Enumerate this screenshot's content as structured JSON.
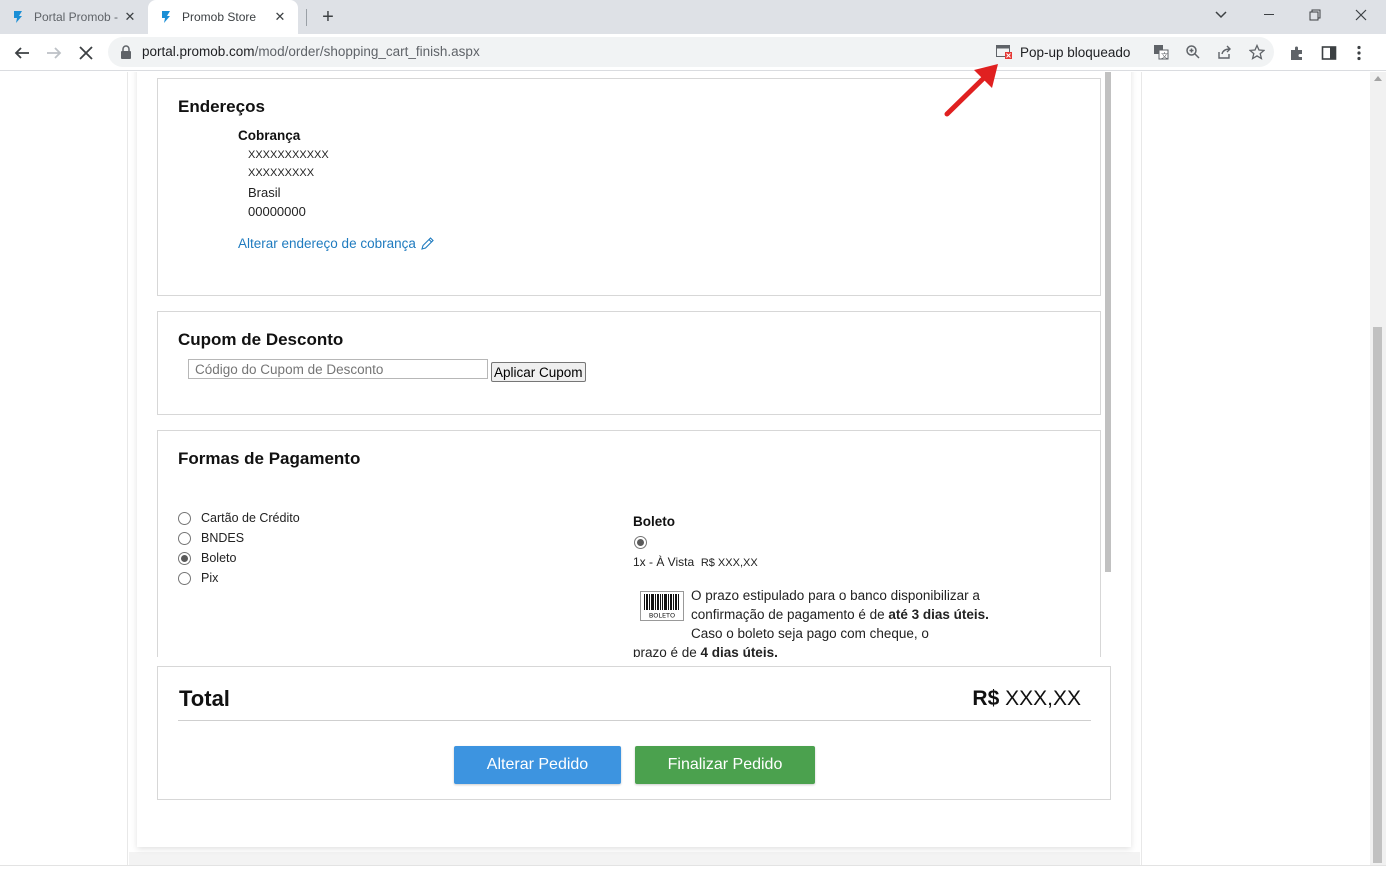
{
  "browser": {
    "tabs": [
      {
        "title": "Portal Promob -",
        "active": false
      },
      {
        "title": "Promob Store",
        "active": true
      }
    ],
    "url_host": "portal.promob.com",
    "url_path": "/mod/order/shopping_cart_finish.aspx",
    "popup_blocked_label": "Pop-up bloqueado",
    "accent_color": "#1f7bbf"
  },
  "enderecos": {
    "title": "Endereços",
    "billing_label": "Cobrança",
    "lines": [
      "XXXXXXXXXXX",
      "XXXXXXXXX",
      "Brasil",
      "00000000"
    ],
    "edit_link": "Alterar endereço de cobrança"
  },
  "cupom": {
    "title": "Cupom de Desconto",
    "placeholder": "Código do Cupom de Desconto",
    "apply_label": "Aplicar Cupom"
  },
  "pagamento": {
    "title": "Formas de Pagamento",
    "options": [
      {
        "label": "Cartão de Crédito",
        "selected": false
      },
      {
        "label": "BNDES",
        "selected": false
      },
      {
        "label": "Boleto",
        "selected": true
      },
      {
        "label": "Pix",
        "selected": false
      }
    ],
    "boleto": {
      "title": "Boleto",
      "installment": "1x - À Vista",
      "price": "R$ XXX,XX",
      "icon_text": "BOLETO",
      "text_a": "O prazo estipulado para o banco disponibilizar a confirmação de pagamento é de ",
      "text_b": "até 3 dias úteis.",
      "text_c": " Caso o boleto seja pago com cheque, o",
      "text_d": "prazo é de ",
      "text_e": "4 dias úteis."
    }
  },
  "total": {
    "label": "Total",
    "currency": "R$",
    "amount": "XXX,XX",
    "alter_button": "Alterar Pedido",
    "finish_button": "Finalizar Pedido",
    "alter_color": "#3d94e0",
    "finish_color": "#4ba14e"
  }
}
